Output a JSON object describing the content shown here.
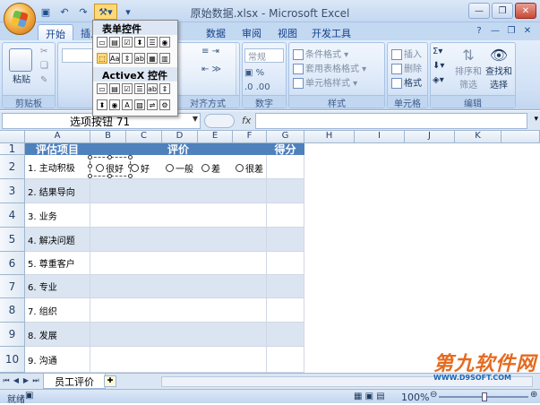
{
  "window": {
    "title": "原始数据.xlsx - Microsoft Excel"
  },
  "tabs": [
    "开始",
    "插入",
    "",
    "",
    "数据",
    "审阅",
    "视图",
    "",
    "开发工具"
  ],
  "ribbon": {
    "paste": "粘贴",
    "clipboard": "剪贴板",
    "alignment": "对齐方式",
    "number_format": "常规",
    "number": "数字",
    "cond_format": "条件格式",
    "table_format": "套用表格格式",
    "cell_style": "单元格样式",
    "styles": "样式",
    "insert": "插入",
    "delete": "删除",
    "format": "格式",
    "cells": "单元格",
    "sort_filter_1": "排序和",
    "sort_filter_2": "筛选",
    "find_select_1": "查找和",
    "find_select_2": "选择",
    "editing": "编辑"
  },
  "dropdown": {
    "form_controls": "表单控件",
    "activex_controls": "ActiveX 控件"
  },
  "formula_bar": {
    "name_box": "选项按钮 71",
    "fx": "fx",
    "formula": ""
  },
  "columns": [
    "A",
    "B",
    "C",
    "D",
    "E",
    "F",
    "G",
    "H",
    "I",
    "J",
    "K"
  ],
  "rows": [
    "1",
    "2",
    "3",
    "4",
    "5",
    "6",
    "7",
    "8",
    "9",
    "10"
  ],
  "table": {
    "header_a": "评估项目",
    "header_eval": "评价",
    "header_score": "得分",
    "items": [
      "1. 主动积极",
      "2. 结果导向",
      "3. 业务",
      "4. 解决问题",
      "5. 尊重客户",
      "6. 专业",
      "7. 组织",
      "8. 发展",
      "9. 沟通"
    ],
    "options": [
      "很好",
      "好",
      "一般",
      "差",
      "很差"
    ]
  },
  "sheet": {
    "tab": "员工评价"
  },
  "status": {
    "ready": "就绪",
    "zoom": "100%"
  },
  "watermark": {
    "line1": "第九软件网",
    "line2": "WWW.D9SOFT.COM"
  }
}
